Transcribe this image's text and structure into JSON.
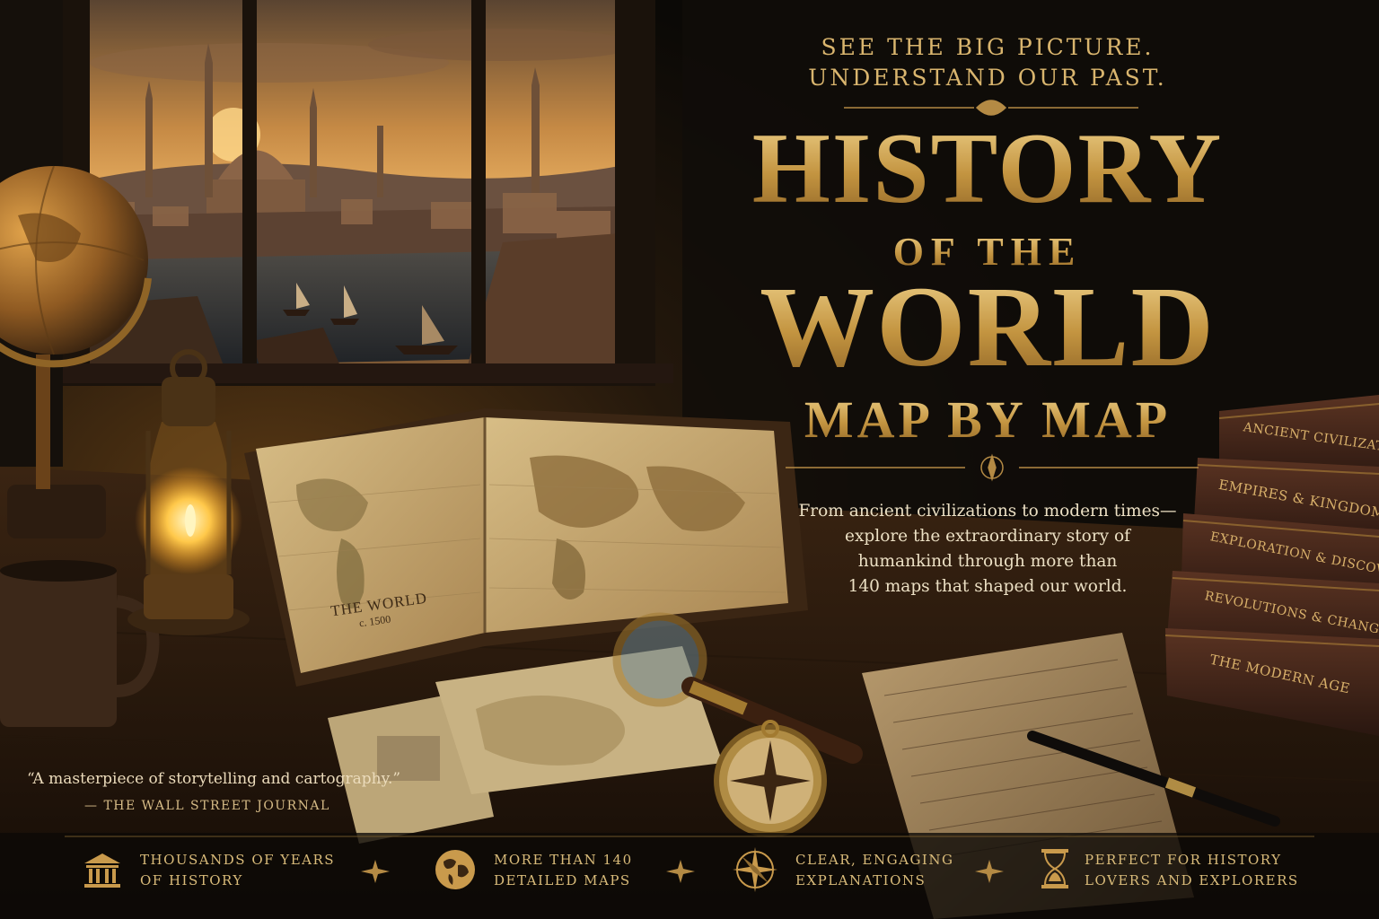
{
  "header": {
    "tagline_line1": "SEE THE BIG PICTURE.",
    "tagline_line2": "UNDERSTAND OUR PAST."
  },
  "title": {
    "line1": "HISTORY",
    "line2": "OF THE",
    "line3": "WORLD",
    "line4": "MAP BY MAP"
  },
  "blurb": {
    "line1": "From ancient civilizations to modern times—",
    "line2": "explore the extraordinary story of",
    "line3": "humankind through more than",
    "line4": "140 maps that shaped our world."
  },
  "quote": {
    "text": "“A masterpiece of storytelling and cartography.”",
    "source": "— THE WALL STREET JOURNAL"
  },
  "open_book": {
    "title": "THE WORLD",
    "date": "c. 1500"
  },
  "book_stack": [
    "ANCIENT CIVILIZATIONS",
    "EMPIRES & KINGDOMS",
    "EXPLORATION & DISCOVERY",
    "REVOLUTIONS & CHANGE",
    "THE MODERN AGE"
  ],
  "features": [
    {
      "icon": "temple-icon",
      "line1": "THOUSANDS OF YEARS",
      "line2": "OF HISTORY"
    },
    {
      "icon": "globe-icon",
      "line1": "MORE THAN 140",
      "line2": "DETAILED MAPS"
    },
    {
      "icon": "compass-rose-icon",
      "line1": "CLEAR, ENGAGING",
      "line2": "EXPLANATIONS"
    },
    {
      "icon": "hourglass-icon",
      "line1": "PERFECT FOR HISTORY",
      "line2": "LOVERS AND EXPLORERS"
    }
  ],
  "colors": {
    "gold": "#c9a04e",
    "background": "#0d0a07",
    "parchment": "#d9c08c"
  }
}
